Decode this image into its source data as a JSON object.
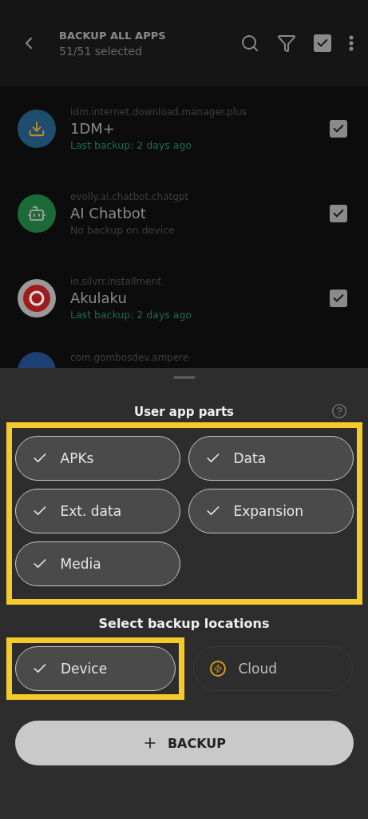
{
  "header": {
    "title": "BACKUP ALL APPS",
    "subtitle": "51/51 selected",
    "select_all_checked": true
  },
  "apps": [
    {
      "package": "idm.internet.download.manager.plus",
      "name": "1DM+",
      "status": "Last backup: 2 days ago",
      "kind": "backed_up",
      "checked": true
    },
    {
      "package": "evolly.ai.chatbot.chatgpt",
      "name": "AI Chatbot",
      "status": "No backup on device",
      "kind": "none",
      "checked": true
    },
    {
      "package": "io.silvrr.installment",
      "name": "Akulaku",
      "status": "Last backup: 2 days ago",
      "kind": "backed_up",
      "checked": true
    },
    {
      "package": "com.gombosdev.ampere",
      "kind": "partial"
    }
  ],
  "sheet": {
    "title": "User app parts",
    "parts_highlighted": true,
    "parts": [
      {
        "label": "APKs",
        "selected": true
      },
      {
        "label": "Data",
        "selected": true
      },
      {
        "label": "Ext. data",
        "selected": true
      },
      {
        "label": "Expansion",
        "selected": true
      },
      {
        "label": "Media",
        "selected": true
      }
    ],
    "locations_title": "Select backup locations",
    "locations": [
      {
        "label": "Device",
        "selected": true,
        "highlighted": true
      },
      {
        "label": "Cloud",
        "selected": false,
        "highlighted": false
      }
    ],
    "action": "BACKUP"
  }
}
